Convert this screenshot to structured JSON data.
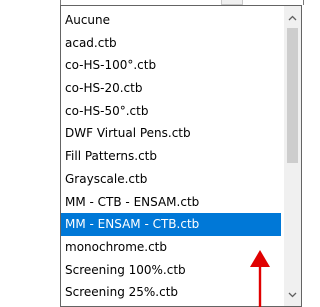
{
  "dropdown": {
    "items": [
      {
        "label": "Aucune"
      },
      {
        "label": "acad.ctb"
      },
      {
        "label": "co-HS-100°.ctb"
      },
      {
        "label": "co-HS-20.ctb"
      },
      {
        "label": "co-HS-50°.ctb"
      },
      {
        "label": "DWF Virtual Pens.ctb"
      },
      {
        "label": "Fill Patterns.ctb"
      },
      {
        "label": "Grayscale.ctb"
      },
      {
        "label": "MM - CTB - ENSAM.ctb"
      },
      {
        "label": "MM - ENSAM - CTB.ctb",
        "selected": true
      },
      {
        "label": "monochrome.ctb"
      },
      {
        "label": "Screening 100%.ctb"
      },
      {
        "label": "Screening 25%.ctb"
      }
    ],
    "scrollbar": {
      "up_icon": "chevron-up-icon",
      "down_icon": "chevron-down-icon"
    }
  },
  "colors": {
    "selection": "#0078d7",
    "annotation_arrow": "#e00000"
  }
}
